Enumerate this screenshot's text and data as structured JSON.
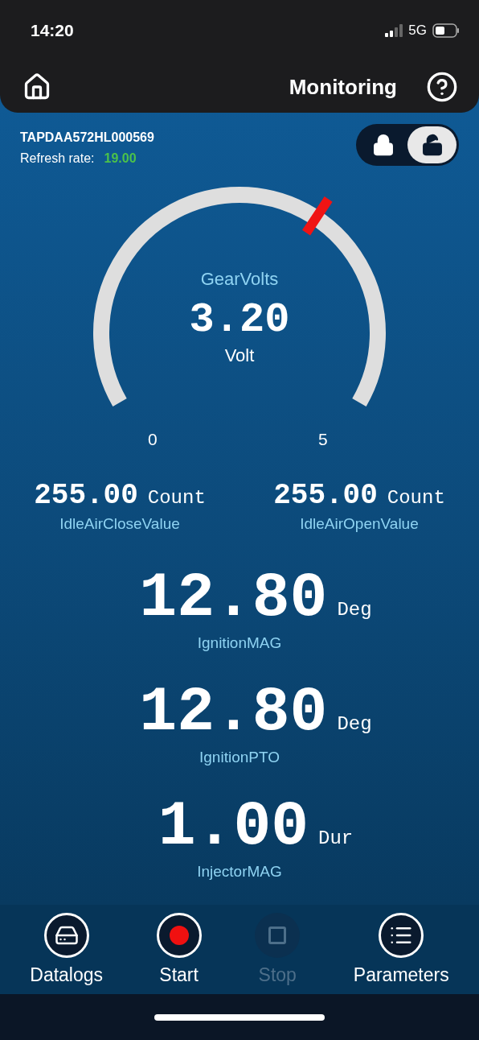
{
  "status_bar": {
    "time": "14:20",
    "network": "5G"
  },
  "header": {
    "title": "Monitoring"
  },
  "device": {
    "id": "TAPDAA572HL000569",
    "refresh_label": "Refresh rate:",
    "refresh_value": "19.00"
  },
  "lock_toggle": [
    {
      "kind": "locked",
      "selected": false
    },
    {
      "kind": "unlocked",
      "selected": true
    }
  ],
  "gauge": {
    "name": "GearVolts",
    "value": "3.20",
    "unit": "Volt",
    "min": "0",
    "max": "5"
  },
  "reading_rows": [
    {
      "kind": "compact",
      "items": [
        {
          "value": "255.00",
          "unit": "Count",
          "name": "IdleAirCloseValue"
        },
        {
          "value": "255.00",
          "unit": "Count",
          "name": "IdleAirOpenValue"
        }
      ]
    },
    {
      "kind": "large",
      "items": [
        {
          "value": "12.80",
          "unit": "Deg",
          "name": "IgnitionMAG"
        }
      ]
    },
    {
      "kind": "large",
      "items": [
        {
          "value": "12.80",
          "unit": "Deg",
          "name": "IgnitionPTO"
        }
      ]
    },
    {
      "kind": "large",
      "items": [
        {
          "value": "1.00",
          "unit": "Dur",
          "name": "InjectorMAG"
        }
      ]
    }
  ],
  "actions": [
    {
      "kind": "datalogs",
      "label": "Datalogs",
      "disabled": false
    },
    {
      "kind": "start",
      "label": "Start",
      "disabled": false
    },
    {
      "kind": "stop",
      "label": "Stop",
      "disabled": true
    },
    {
      "kind": "parameters",
      "label": "Parameters",
      "disabled": false
    }
  ]
}
